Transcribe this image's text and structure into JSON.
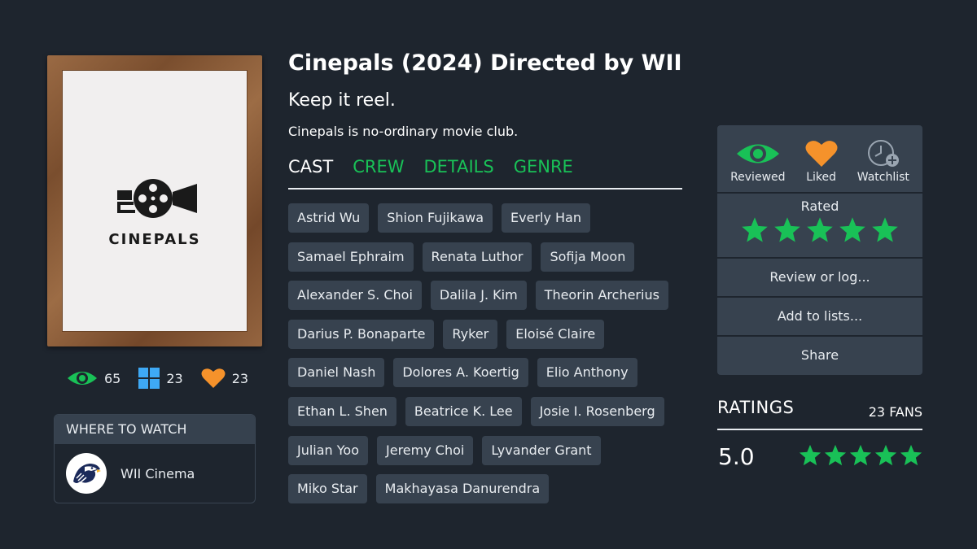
{
  "movie": {
    "title": "Cinepals (2024) Directed by WII",
    "tagline": "Keep it reel.",
    "description": "Cinepals is no-ordinary movie club.",
    "poster_logo_text": "CINEPALS"
  },
  "stats": {
    "views": "65",
    "lists": "23",
    "likes": "23"
  },
  "where_to_watch": {
    "header": "WHERE TO WATCH",
    "service_name": "WII Cinema"
  },
  "tabs": [
    "CAST",
    "CREW",
    "DETAILS",
    "GENRE"
  ],
  "active_tab": "CAST",
  "cast_rows": [
    [
      "Astrid Wu",
      "Shion Fujikawa",
      "Everly Han"
    ],
    [
      "Samael Ephraim",
      "Renata Luthor",
      "Sofija Moon"
    ],
    [
      "Alexander S. Choi",
      "Dalila J. Kim",
      "Theorin Archerius"
    ],
    [
      "Darius P. Bonaparte",
      "Ryker",
      "Eloisé Claire"
    ],
    [
      "Daniel Nash",
      "Dolores A. Koertig",
      "Elio Anthony"
    ],
    [
      "Ethan L. Shen",
      "Beatrice K. Lee",
      "Josie I. Rosenberg"
    ],
    [
      "Julian Yoo",
      "Jeremy Choi",
      "Lyvander Grant"
    ],
    [
      "Miko Star",
      "Makhayasa Danurendra"
    ]
  ],
  "panel": {
    "reviewed_label": "Reviewed",
    "liked_label": "Liked",
    "watchlist_label": "Watchlist",
    "rated_label": "Rated",
    "rating_stars": 5,
    "review_label": "Review or log...",
    "lists_label": "Add to lists...",
    "share_label": "Share"
  },
  "ratings": {
    "title": "RATINGS",
    "fans": "23 FANS",
    "score": "5.0",
    "stars": 5
  },
  "colors": {
    "background": "#1e252e",
    "chip": "#37424f",
    "accent_green": "#19c157",
    "accent_orange": "#f5922b",
    "accent_blue": "#3ea9f5"
  },
  "icons": [
    "eye-icon",
    "lists-grid-icon",
    "heart-icon",
    "clock-plus-icon",
    "star-icon",
    "film-camera-icon",
    "eagle-logo"
  ]
}
